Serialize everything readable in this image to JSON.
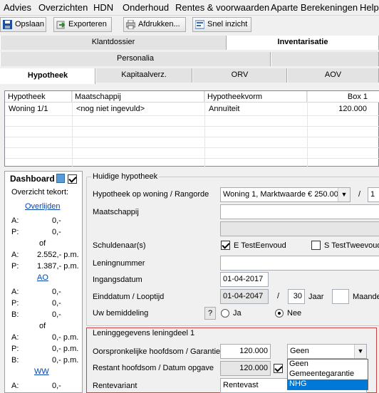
{
  "menu": [
    "Advies",
    "Overzichten",
    "HDN",
    "Onderhoud",
    "Rentes & voorwaarden",
    "Aparte Berekeningen",
    "Help"
  ],
  "toolbar": {
    "save": "Opslaan",
    "export": "Exporteren",
    "print": "Afdrukken...",
    "quick": "Snel inzicht"
  },
  "tabs_top": {
    "klantdossier": "Klantdossier",
    "inventarisatie": "Inventarisatie"
  },
  "tabs_mid": {
    "personalia": "Personalia"
  },
  "tabs_sub": {
    "hypotheek": "Hypotheek",
    "kapitaal": "Kapitaalverz.",
    "orv": "ORV",
    "aov": "AOV"
  },
  "grid": {
    "headers": [
      "Hypotheek",
      "Maatschappij",
      "Hypotheekvorm",
      "Box 1"
    ],
    "row": [
      "Woning 1/1",
      "<nog niet ingevuld>",
      "Annuïteit",
      "120.000"
    ]
  },
  "dashboard": {
    "title": "Dashboard",
    "subtitle": "Overzicht tekort:",
    "overlijden": "Overlijden",
    "ao": "AO",
    "ww": "WW",
    "rows1": [
      {
        "k": "A:",
        "v": "0,-"
      },
      {
        "k": "P:",
        "v": "0,-"
      }
    ],
    "of1": "of",
    "rows2": [
      {
        "k": "A:",
        "v": "2.552,- p.m."
      },
      {
        "k": "P:",
        "v": "1.387,- p.m."
      }
    ],
    "rows3": [
      {
        "k": "A:",
        "v": "0,-"
      },
      {
        "k": "P:",
        "v": "0,-"
      },
      {
        "k": "B:",
        "v": "0,-"
      }
    ],
    "of2": "of",
    "rows4": [
      {
        "k": "A:",
        "v": "0,- p.m."
      },
      {
        "k": "P:",
        "v": "0,- p.m."
      },
      {
        "k": "B:",
        "v": "0,- p.m."
      }
    ],
    "rows5": [
      {
        "k": "A:",
        "v": "0,-"
      }
    ]
  },
  "huidige": {
    "title": "Huidige hypotheek",
    "rangorde_label": "Hypotheek op woning / Rangorde",
    "woning_value": "Woning 1, Marktwaarde € 250.00",
    "slash": "/",
    "rangorde_value": "1",
    "maatschappij_label": "Maatschappij",
    "schuldenaar_label": "Schuldenaar(s)",
    "schuldenaar1": "E TestEenvoud",
    "schuldenaar2": "S TestTweevoud",
    "leningnummer_label": "Leningnummer",
    "ingangsdatum_label": "Ingangsdatum",
    "ingangsdatum": "01-04-2017",
    "einddatum_label": "Einddatum / Looptijd",
    "einddatum": "01-04-2047",
    "looptijd": "30",
    "jaar": "Jaar",
    "maanden": "Maanden",
    "bemiddeling_label": "Uw bemiddeling",
    "help": "?",
    "ja": "Ja",
    "nee": "Nee"
  },
  "lening": {
    "title": "Leninggegevens leningdeel 1",
    "hoofdsom_label": "Oorspronkelijke hoofdsom / Garantie",
    "hoofdsom": "120.000",
    "garantie_selected": "Geen",
    "restant_label": "Restant hoofdsom / Datum opgave",
    "restant": "120.000",
    "rentevariant_label": "Rentevariant",
    "rentevariant": "Rentevast",
    "options": [
      "Geen",
      "Gemeentegarantie",
      "NHG"
    ]
  },
  "colors": {
    "accent": "#0078d7",
    "group_red": "#d04040"
  }
}
